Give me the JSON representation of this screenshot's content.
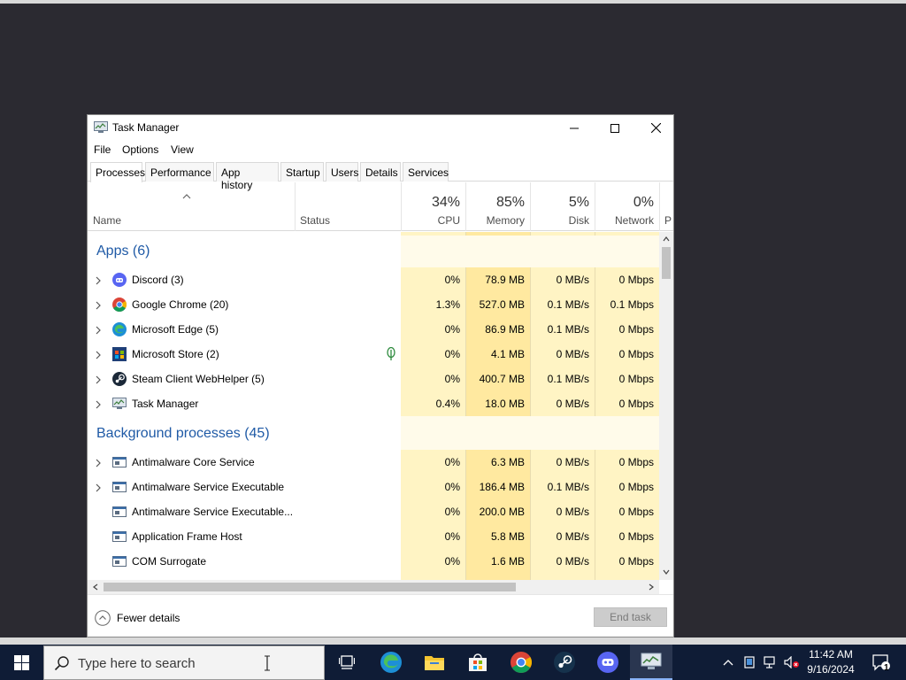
{
  "window": {
    "title": "Task Manager",
    "controls": {
      "minimize": "minimize",
      "maximize": "maximize",
      "close": "close"
    }
  },
  "menu": [
    "File",
    "Options",
    "View"
  ],
  "tabs": [
    {
      "label": "Processes",
      "active": true
    },
    {
      "label": "Performance",
      "active": false
    },
    {
      "label": "App history",
      "active": false
    },
    {
      "label": "Startup",
      "active": false
    },
    {
      "label": "Users",
      "active": false
    },
    {
      "label": "Details",
      "active": false
    },
    {
      "label": "Services",
      "active": false
    }
  ],
  "columns": {
    "name": "Name",
    "status": "Status",
    "cpu": {
      "pct": "34%",
      "label": "CPU"
    },
    "memory": {
      "pct": "85%",
      "label": "Memory"
    },
    "disk": {
      "pct": "5%",
      "label": "Disk"
    },
    "network": {
      "pct": "0%",
      "label": "Network"
    },
    "power": {
      "label": "P"
    }
  },
  "groups": {
    "apps": "Apps (6)",
    "background": "Background processes (45)"
  },
  "apps": [
    {
      "name": "Discord (3)",
      "icon": "discord-icon",
      "expandable": true,
      "cpu": "0%",
      "memory": "78.9 MB",
      "disk": "0 MB/s",
      "network": "0 Mbps"
    },
    {
      "name": "Google Chrome (20)",
      "icon": "chrome-icon",
      "expandable": true,
      "cpu": "1.3%",
      "memory": "527.0 MB",
      "disk": "0.1 MB/s",
      "network": "0.1 Mbps"
    },
    {
      "name": "Microsoft Edge (5)",
      "icon": "edge-icon",
      "expandable": true,
      "cpu": "0%",
      "memory": "86.9 MB",
      "disk": "0.1 MB/s",
      "network": "0 Mbps"
    },
    {
      "name": "Microsoft Store (2)",
      "icon": "store-icon",
      "expandable": true,
      "suspended": true,
      "cpu": "0%",
      "memory": "4.1 MB",
      "disk": "0 MB/s",
      "network": "0 Mbps"
    },
    {
      "name": "Steam Client WebHelper (5)",
      "icon": "steam-icon",
      "expandable": true,
      "cpu": "0%",
      "memory": "400.7 MB",
      "disk": "0.1 MB/s",
      "network": "0 Mbps"
    },
    {
      "name": "Task Manager",
      "icon": "task-manager-icon",
      "expandable": true,
      "cpu": "0.4%",
      "memory": "18.0 MB",
      "disk": "0 MB/s",
      "network": "0 Mbps"
    }
  ],
  "background": [
    {
      "name": "Antimalware Core Service",
      "icon": "service-icon",
      "expandable": true,
      "cpu": "0%",
      "memory": "6.3 MB",
      "disk": "0 MB/s",
      "network": "0 Mbps"
    },
    {
      "name": "Antimalware Service Executable",
      "icon": "service-icon",
      "expandable": true,
      "cpu": "0%",
      "memory": "186.4 MB",
      "disk": "0.1 MB/s",
      "network": "0 Mbps"
    },
    {
      "name": "Antimalware Service Executable...",
      "icon": "service-icon",
      "expandable": false,
      "cpu": "0%",
      "memory": "200.0 MB",
      "disk": "0 MB/s",
      "network": "0 Mbps"
    },
    {
      "name": "Application Frame Host",
      "icon": "service-icon",
      "expandable": false,
      "cpu": "0%",
      "memory": "5.8 MB",
      "disk": "0 MB/s",
      "network": "0 Mbps"
    },
    {
      "name": "COM Surrogate",
      "icon": "service-icon",
      "expandable": false,
      "cpu": "0%",
      "memory": "1.6 MB",
      "disk": "0 MB/s",
      "network": "0 Mbps"
    }
  ],
  "footer": {
    "fewer_details": "Fewer details",
    "end_task": "End task"
  },
  "taskbar": {
    "search_placeholder": "Type here to search",
    "pinned": [
      "task-view-icon",
      "edge-icon",
      "file-explorer-icon",
      "store-icon",
      "chrome-icon",
      "steam-icon",
      "discord-icon",
      "task-manager-icon"
    ],
    "time": "11:42 AM",
    "date": "9/16/2024",
    "notification_count": "1"
  },
  "colors": {
    "heat_light": "#fff4c4",
    "heat_mid": "#ffe9a0",
    "group_blue": "#1f5aa6",
    "taskbar": "#0f1c36"
  }
}
